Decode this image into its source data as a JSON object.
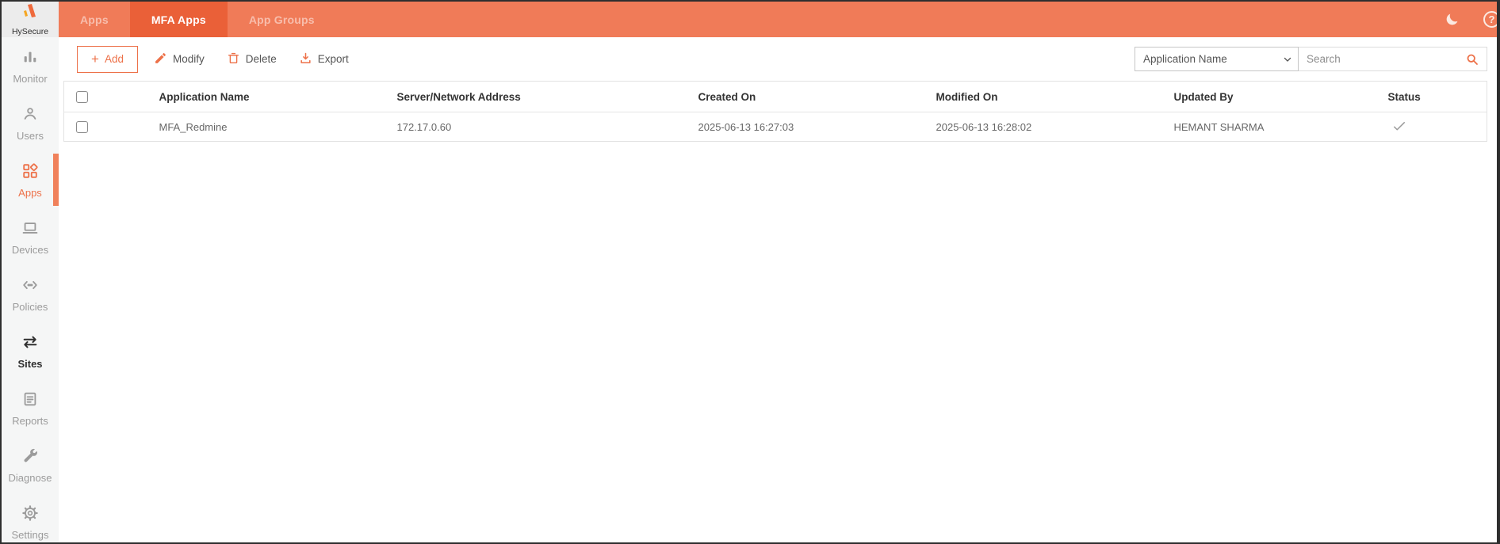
{
  "app": {
    "name": "HySecure"
  },
  "topbar": {
    "tabs": [
      {
        "label": "Apps",
        "active": false
      },
      {
        "label": "MFA Apps",
        "active": true
      },
      {
        "label": "App Groups",
        "active": false
      }
    ]
  },
  "sidebar": {
    "items": [
      {
        "label": "Monitor",
        "icon": "bar-chart-icon",
        "active": false
      },
      {
        "label": "Users",
        "icon": "user-icon",
        "active": false
      },
      {
        "label": "Apps",
        "icon": "apps-grid-icon",
        "active": true
      },
      {
        "label": "Devices",
        "icon": "laptop-icon",
        "active": false
      },
      {
        "label": "Policies",
        "icon": "code-brackets-icon",
        "active": false
      },
      {
        "label": "Sites",
        "icon": "swap-arrows-icon",
        "active": false
      },
      {
        "label": "Reports",
        "icon": "report-doc-icon",
        "active": false
      },
      {
        "label": "Diagnose",
        "icon": "wrench-icon",
        "active": false
      },
      {
        "label": "Settings",
        "icon": "gear-icon",
        "active": false
      }
    ]
  },
  "toolbar": {
    "add_label": "Add",
    "modify_label": "Modify",
    "delete_label": "Delete",
    "export_label": "Export"
  },
  "filter": {
    "selected_option": "Application Name",
    "search_placeholder": "Search"
  },
  "table": {
    "columns": [
      "Application Name",
      "Server/Network Address",
      "Created On",
      "Modified On",
      "Updated By",
      "Status"
    ],
    "rows": [
      {
        "application_name": "MFA_Redmine",
        "server_address": "172.17.0.60",
        "created_on": "2025-06-13 16:27:03",
        "modified_on": "2025-06-13 16:28:02",
        "updated_by": "HEMANT SHARMA",
        "status": "enabled-check"
      }
    ]
  },
  "colors": {
    "topbar_bg": "#F07B58",
    "active_tab_bg": "#EA6038",
    "accent_orange": "#ED7149",
    "sidebar_bg": "#F5F6F6",
    "active_indicator": "#F0815B",
    "status_check": "#9a9a9a"
  }
}
